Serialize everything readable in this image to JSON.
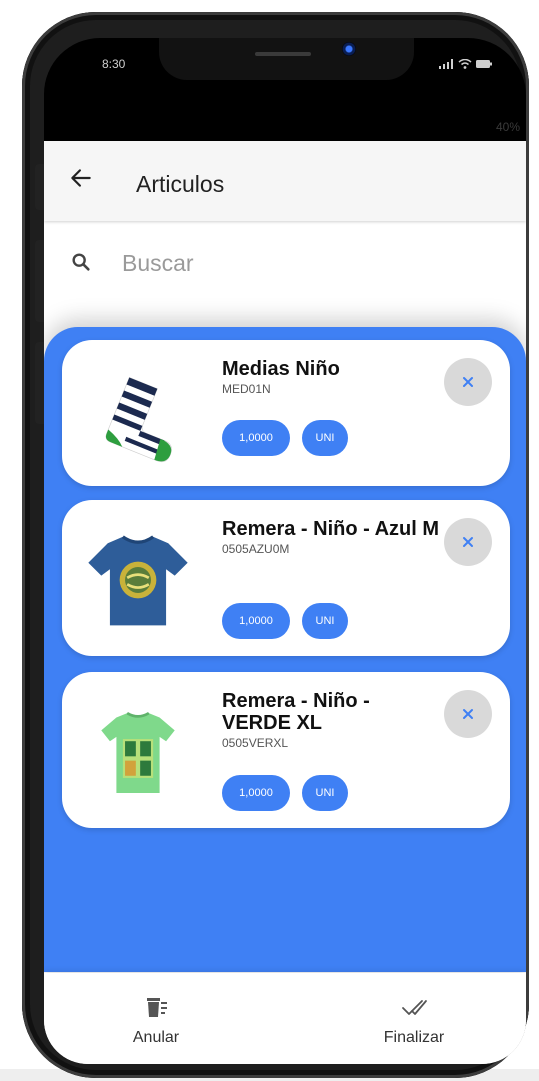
{
  "status_bar": {
    "time": "8:30",
    "battery": "40%"
  },
  "header": {
    "title": "Articulos"
  },
  "search": {
    "placeholder": "Buscar"
  },
  "items": [
    {
      "name": "Medias Niño",
      "code": "MED01N",
      "quantity": "1,0000",
      "unit": "UNI"
    },
    {
      "name": "Remera - Niño - Azul M",
      "code": "0505AZU0M",
      "quantity": "1,0000",
      "unit": "UNI"
    },
    {
      "name": "Remera - Niño - VERDE XL",
      "code": "0505VERXL",
      "quantity": "1,0000",
      "unit": "UNI"
    }
  ],
  "bottom_nav": {
    "cancel_label": "Anular",
    "finish_label": "Finalizar"
  },
  "colors": {
    "accent": "#3f80f4",
    "remove_button": "#d9d9d9",
    "app_bar": "#f6f6f6"
  },
  "icons": [
    "back-arrow-icon",
    "search-icon",
    "close-icon",
    "trash-icon",
    "double-check-icon",
    "signal-icon",
    "wifi-icon",
    "battery-icon"
  ]
}
